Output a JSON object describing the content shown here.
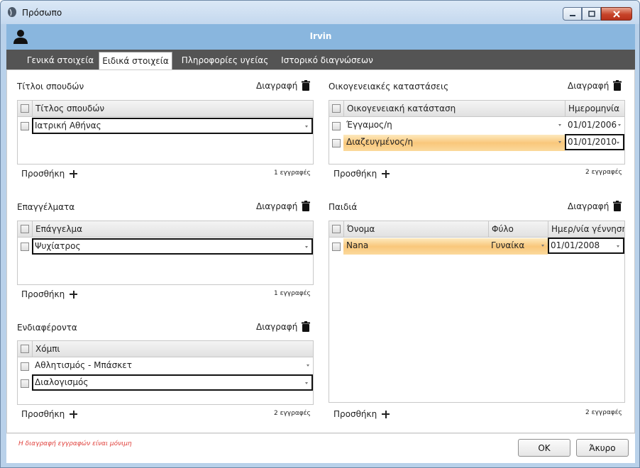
{
  "window": {
    "title": "Πρόσωπο"
  },
  "header": {
    "username": "Irvin"
  },
  "tabs": [
    {
      "label": "Γενικά στοιχεία"
    },
    {
      "label": "Ειδικά στοιχεία"
    },
    {
      "label": "Πληροφορίες υγείας"
    },
    {
      "label": "Ιστορικό διαγνώσεων"
    }
  ],
  "common": {
    "delete_label": "Διαγραφή",
    "add_label": "Προσθήκη"
  },
  "degrees": {
    "title": "Τίτλοι σπουδών",
    "col": "Τίτλος σπουδών",
    "rows": [
      "Ιατρική Αθήνας"
    ],
    "count": "1 εγγραφές"
  },
  "professions": {
    "title": "Επαγγέλματα",
    "col": "Επάγγελμα",
    "rows": [
      "Ψυχίατρος"
    ],
    "count": "1 εγγραφές"
  },
  "interests": {
    "title": "Ενδιαφέροντα",
    "col": "Χόμπι",
    "rows": [
      "Αθλητισμός - Μπάσκετ",
      "Διαλογισμός"
    ],
    "count": "2 εγγραφές"
  },
  "marital": {
    "title": "Οικογενειακές καταστάσεις",
    "cols": [
      "Οικογενειακή κατάσταση",
      "Ημερομηνία"
    ],
    "rows": [
      {
        "status": "Έγγαμος/η",
        "date": "01/01/2006"
      },
      {
        "status": "Διαζευγμένος/η",
        "date": "01/01/2010"
      }
    ],
    "count": "2 εγγραφές"
  },
  "children": {
    "title": "Παιδιά",
    "cols": [
      "Όνομα",
      "Φύλο",
      "Ημερ/νία γέννησης"
    ],
    "rows": [
      {
        "name": "Nana",
        "gender": "Γυναίκα",
        "birth": "01/01/2008"
      }
    ]
  },
  "footer": {
    "note": "Η διαγραφή εγγραφών είναι μόνιμη",
    "ok": "OK",
    "cancel": "Άκυρο"
  },
  "colors": {
    "header": "#89b6de",
    "tabbar": "#545454",
    "highlight": "#f9c77b",
    "warning": "#e0413c"
  }
}
